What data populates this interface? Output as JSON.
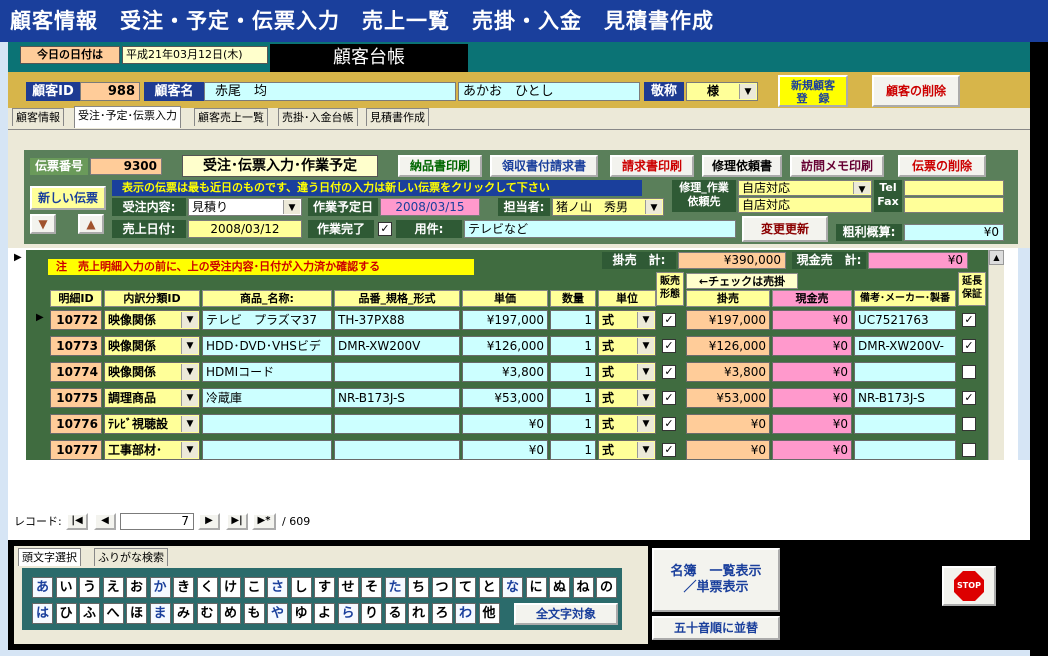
{
  "window": {
    "title": "顧客情報　受注・予定・伝票入力　売上一覧　売掛・入金　見積書作成"
  },
  "header": {
    "today_label": "今日の日付は",
    "today_value": "平成21年03月12日(木)",
    "page_title": "顧客台帳"
  },
  "customer": {
    "id_label": "顧客ID",
    "id_value": "988",
    "name_label": "顧客名",
    "name_value": "赤尾　均",
    "kana_value": "あかお　ひとし",
    "honorific_label": "敬称",
    "honorific_value": "様",
    "new_button": "新規顧客\n登　録",
    "delete_button": "顧客の削除"
  },
  "tabs": [
    "顧客情報",
    "受注･予定･伝票入力",
    "顧客売上一覧",
    "売掛･入金台帳",
    "見積書作成"
  ],
  "slip": {
    "number_label": "伝票番号",
    "number_value": "9300",
    "section_title": "受注･伝票入力･作業予定",
    "print_delivery": "納品書印刷",
    "print_receipt": "領収書付請求書",
    "print_invoice": "請求書印刷",
    "repair_request": "修理依頼書",
    "visit_memo": "訪問メモ印刷",
    "delete_slip": "伝票の削除",
    "new_slip": "新しい伝票",
    "notice": "表示の伝票は最も近日のものです、違う日付の入力は新しい伝票をクリックして下さい",
    "order_label": "受注内容:",
    "order_value": "見積り",
    "work_date_label": "作業予定日",
    "work_date_value": "2008/03/15",
    "staff_label": "担当者:",
    "staff_value": "猪ノ山　秀男",
    "sale_date_label": "売上日付:",
    "sale_date_value": "2008/03/12",
    "work_done_label": "作業完了",
    "work_done_checked": "✓",
    "subject_label": "用件:",
    "subject_value": "テレビなど",
    "repair_label": "修理_作業\n依頼先",
    "repair_value1": "自店対応",
    "repair_value2": "自店対応",
    "tel_label": "Tel\nFax",
    "tel_value": "",
    "fax_value": "",
    "update_button": "変更更新",
    "profit_label": "粗利概算:",
    "profit_value": "¥0"
  },
  "details": {
    "warning": "注　売上明細入力の前に、上の受注内容･日付が入力済か確認する",
    "credit_total_label": "掛売　計:",
    "credit_total_value": "¥390,000",
    "cash_total_label": "現金売　計:",
    "cash_total_value": "¥0",
    "check_note": "←チェックは売掛",
    "headers": [
      "明細ID",
      "内訳分類ID",
      "商品_名称:",
      "品番_規格_形式",
      "単価",
      "数量",
      "単位",
      "販売\n形態",
      "掛売",
      "現金売",
      "備考･メーカー･製番",
      "延長\n保証"
    ],
    "rows": [
      {
        "id": "10772",
        "category": "映像関係",
        "name": "テレビ　プラズマ37",
        "model": "TH-37PX88",
        "price": "¥197,000",
        "qty": "1",
        "unit": "式",
        "sale": "✓",
        "credit": "¥197,000",
        "cash": "¥0",
        "note": "UC7521763",
        "warranty": "✓"
      },
      {
        "id": "10773",
        "category": "映像関係",
        "name": "HDD･DVD･VHSビデ",
        "model": "DMR-XW200V",
        "price": "¥126,000",
        "qty": "1",
        "unit": "式",
        "sale": "✓",
        "credit": "¥126,000",
        "cash": "¥0",
        "note": "DMR-XW200V-",
        "warranty": "✓"
      },
      {
        "id": "10774",
        "category": "映像関係",
        "name": "HDMIコード",
        "model": "",
        "price": "¥3,800",
        "qty": "1",
        "unit": "式",
        "sale": "✓",
        "credit": "¥3,800",
        "cash": "¥0",
        "note": "",
        "warranty": ""
      },
      {
        "id": "10775",
        "category": "調理商品",
        "name": "冷蔵庫",
        "model": "NR-B173J-S",
        "price": "¥53,000",
        "qty": "1",
        "unit": "式",
        "sale": "✓",
        "credit": "¥53,000",
        "cash": "¥0",
        "note": "NR-B173J-S",
        "warranty": "✓"
      },
      {
        "id": "10776",
        "category": "ﾃﾚﾋﾞ視聴設",
        "name": "",
        "model": "",
        "price": "¥0",
        "qty": "1",
        "unit": "式",
        "sale": "✓",
        "credit": "¥0",
        "cash": "¥0",
        "note": "",
        "warranty": ""
      },
      {
        "id": "10777",
        "category": "工事部材･",
        "name": "",
        "model": "",
        "price": "¥0",
        "qty": "1",
        "unit": "式",
        "sale": "✓",
        "credit": "¥0",
        "cash": "¥0",
        "note": "",
        "warranty": ""
      }
    ]
  },
  "record_nav": {
    "label": "レコード:",
    "current": "7",
    "total": "/ 609"
  },
  "bottom": {
    "tab1": "頭文字選択",
    "tab2": "ふりがな検索",
    "kana_row1": [
      "あ",
      "い",
      "う",
      "え",
      "お",
      "か",
      "き",
      "く",
      "け",
      "こ",
      "さ",
      "し",
      "す",
      "せ",
      "そ",
      "た",
      "ち",
      "つ",
      "て",
      "と",
      "な",
      "に",
      "ぬ",
      "ね",
      "の"
    ],
    "kana_row2": [
      "は",
      "ひ",
      "ふ",
      "へ",
      "ほ",
      "ま",
      "み",
      "む",
      "め",
      "も",
      "や",
      "ゆ",
      "よ",
      "ら",
      "り",
      "る",
      "れ",
      "ろ",
      "わ",
      "他"
    ],
    "all_button": "全文字対象",
    "list_button": "名簿　一覧表示\n／単票表示",
    "sort_button": "五十音順に並替",
    "stop": "STOP"
  }
}
